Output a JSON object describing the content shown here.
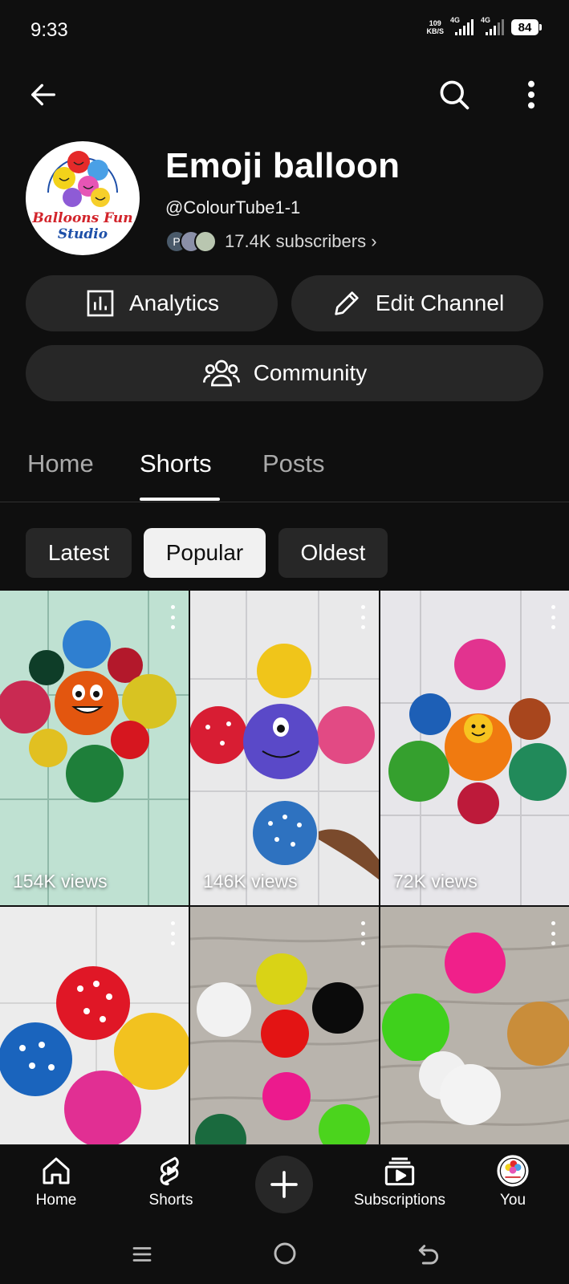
{
  "status_bar": {
    "time": "9:33",
    "net_speed_top": "109",
    "net_speed_bottom": "KB/S",
    "signal1_label": "4G",
    "signal2_label": "4G",
    "battery": "84"
  },
  "channel": {
    "title": "Emoji balloon",
    "handle": "@ColourTube1-1",
    "subscribers": "17.4K subscribers ›",
    "avatar_logo_line1": "Balloons Fun",
    "avatar_logo_line2": "Studio",
    "mini_avatar_letter": "P"
  },
  "actions": {
    "analytics_label": "Analytics",
    "edit_label": "Edit Channel",
    "community_label": "Community"
  },
  "tabs": [
    {
      "label": "Home",
      "active": false
    },
    {
      "label": "Shorts",
      "active": true
    },
    {
      "label": "Posts",
      "active": false
    }
  ],
  "chips": [
    {
      "label": "Latest",
      "selected": false
    },
    {
      "label": "Popular",
      "selected": true
    },
    {
      "label": "Oldest",
      "selected": false
    }
  ],
  "shorts": [
    {
      "views": "154K views"
    },
    {
      "views": "146K views"
    },
    {
      "views": "72K views"
    },
    {
      "views": ""
    },
    {
      "views": ""
    },
    {
      "views": ""
    }
  ],
  "bottom_nav": {
    "home": "Home",
    "shorts": "Shorts",
    "subscriptions": "Subscriptions",
    "you": "You"
  },
  "icons": {
    "back": "arrow-left-icon",
    "search": "search-icon",
    "more": "more-vertical-icon",
    "analytics": "bar-chart-icon",
    "edit": "pencil-icon",
    "community": "people-icon",
    "create": "plus-icon"
  },
  "colors": {
    "background": "#0f0f0f",
    "surface": "#272727",
    "text": "#f1f1f1",
    "muted": "#aaaaaa"
  }
}
